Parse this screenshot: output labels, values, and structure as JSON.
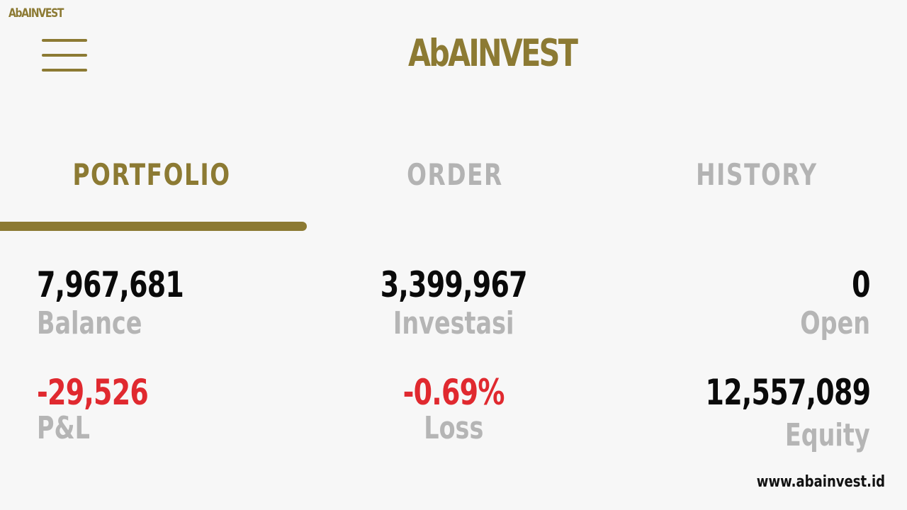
{
  "header": {
    "small_logo": "AbAINVEST",
    "main_logo": "AbAINVEST",
    "menu_icon": "hamburger-menu-icon"
  },
  "tabs": [
    {
      "label": "PORTFOLIO",
      "active": true
    },
    {
      "label": "ORDER",
      "active": false
    },
    {
      "label": "HISTORY",
      "active": false
    }
  ],
  "stats": {
    "balance": {
      "value": "7,967,681",
      "label": "Balance"
    },
    "investasi": {
      "value": "3,399,967",
      "label": "Investasi"
    },
    "open": {
      "value": "0",
      "label": "Open"
    },
    "pnl": {
      "value": "-29,526",
      "label": "P&L"
    },
    "loss": {
      "value": "-0.69%",
      "label": "Loss"
    },
    "equity": {
      "value": "12,557,089",
      "label": "Equity"
    }
  },
  "footer": {
    "website": "www.abainvest.id"
  },
  "colors": {
    "brand_gold": "#8c7a33",
    "negative_red": "#e0292f",
    "inactive_gray": "#b3b3b3",
    "background": "#f7f7f7"
  }
}
